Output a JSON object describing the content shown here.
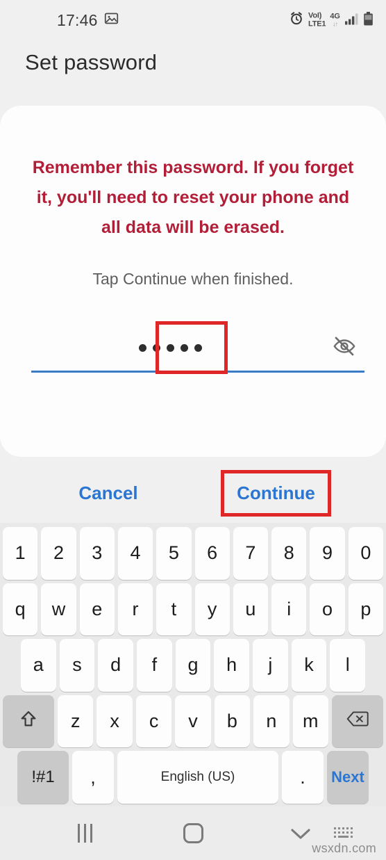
{
  "status_bar": {
    "time": "17:46",
    "icons": {
      "gallery": "image-icon",
      "alarm": "alarm-icon",
      "signal": "signal-bars-icon",
      "battery": "battery-icon"
    },
    "volte_label_top": "VoI)",
    "volte_label_bottom": "LTE1",
    "network_label": "4G",
    "network_arrows": "↓↑"
  },
  "header": {
    "title": "Set password"
  },
  "card": {
    "warning": "Remember this password. If you forget it, you'll need to reset your phone and all data will be erased.",
    "hint": "Tap Continue when finished.",
    "password_field": {
      "masked_value": "•••••",
      "dot_count": 5,
      "placeholder": "",
      "reveal_icon": "eye-off-icon"
    }
  },
  "actions": {
    "cancel_label": "Cancel",
    "continue_label": "Continue"
  },
  "annotations": {
    "password_box": "red-highlight-password-field",
    "continue_box": "red-highlight-continue-button"
  },
  "keyboard": {
    "row_numbers": [
      "1",
      "2",
      "3",
      "4",
      "5",
      "6",
      "7",
      "8",
      "9",
      "0"
    ],
    "row_top": [
      "q",
      "w",
      "e",
      "r",
      "t",
      "y",
      "u",
      "i",
      "o",
      "p"
    ],
    "row_home": [
      "a",
      "s",
      "d",
      "f",
      "g",
      "h",
      "j",
      "k",
      "l"
    ],
    "row_shift": {
      "shift_icon": "shift-arrow-icon",
      "letters": [
        "z",
        "x",
        "c",
        "v",
        "b",
        "n",
        "m"
      ],
      "backspace_icon": "backspace-icon"
    },
    "row_bottom": {
      "symbols_label": "!#1",
      "comma_label": ",",
      "space_label": "English (US)",
      "period_label": ".",
      "next_label": "Next"
    }
  },
  "nav_bar": {
    "recents": "recents-icon",
    "home": "home-icon",
    "dismiss_keyboard": "chevron-down-icon",
    "switch_keyboard": "keyboard-switch-icon"
  },
  "watermark": "wsxdn.com",
  "colors": {
    "background": "#f0f0f0",
    "card": "#fdfdfd",
    "warning_red": "#b21e37",
    "annotation_red": "#e02727",
    "action_blue": "#2a76d2",
    "underline_blue": "#3a7bc8",
    "key_white": "#fdfdfd",
    "key_gray": "#c9c9c9"
  }
}
